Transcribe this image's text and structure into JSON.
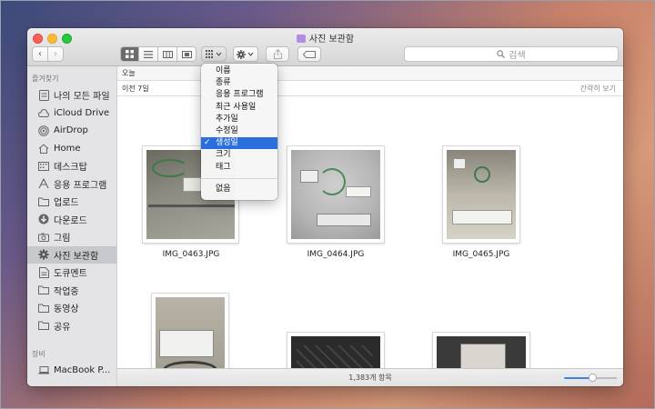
{
  "window": {
    "title": "사진 보관함"
  },
  "toolbar": {
    "back": "‹",
    "forward": "›",
    "search_placeholder": "검색"
  },
  "sidebar": {
    "favorites_heading": "즐겨찾기",
    "items": [
      {
        "label": "나의 모든 파일",
        "icon": "all-files-icon"
      },
      {
        "label": "iCloud Drive",
        "icon": "cloud-icon"
      },
      {
        "label": "AirDrop",
        "icon": "airdrop-icon"
      },
      {
        "label": "Home",
        "icon": "home-icon"
      },
      {
        "label": "데스크탑",
        "icon": "desktop-icon"
      },
      {
        "label": "응용 프로그램",
        "icon": "applications-icon"
      },
      {
        "label": "업로드",
        "icon": "folder-icon"
      },
      {
        "label": "다운로드",
        "icon": "download-icon"
      },
      {
        "label": "그림",
        "icon": "camera-icon"
      },
      {
        "label": "사진 보관함",
        "icon": "gear-icon",
        "selected": true
      },
      {
        "label": "도큐멘트",
        "icon": "document-icon"
      },
      {
        "label": "작업중",
        "icon": "folder-icon"
      },
      {
        "label": "동영상",
        "icon": "folder-icon"
      },
      {
        "label": "공유",
        "icon": "folder-icon"
      }
    ],
    "devices_heading": "장비",
    "devices": [
      {
        "label": "MacBook P...",
        "icon": "laptop-icon"
      }
    ]
  },
  "sections": {
    "today": "오늘",
    "last7": "이전 7일",
    "collapse": "간략히 보기"
  },
  "photos": [
    {
      "name": "IMG_0463.JPG"
    },
    {
      "name": "IMG_0464.JPG"
    },
    {
      "name": "IMG_0465.JPG"
    }
  ],
  "status": {
    "count": "1,383개 항목",
    "zoom_fraction": 0.55
  },
  "menu": {
    "items": [
      {
        "label": "이름"
      },
      {
        "label": "종류"
      },
      {
        "label": "응용 프로그램"
      },
      {
        "label": "최근 사용일"
      },
      {
        "label": "추가일"
      },
      {
        "label": "수정일"
      },
      {
        "label": "생성일",
        "checked": true
      },
      {
        "label": "크기"
      },
      {
        "label": "태그"
      }
    ],
    "none": "없음",
    "check_mark": "✓"
  },
  "colors": {
    "selection": "#2b6fde",
    "slider": "#3b82f6"
  }
}
